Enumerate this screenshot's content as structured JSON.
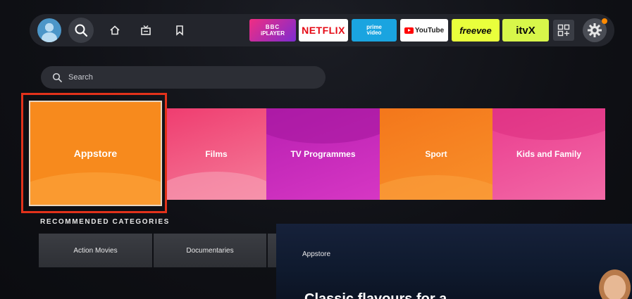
{
  "nav": {
    "items": [
      {
        "icon": "home-icon"
      },
      {
        "icon": "live-tv-icon"
      },
      {
        "icon": "bookmark-icon"
      }
    ],
    "apps": [
      {
        "name": "bbc_iplayer",
        "line1": "BBC",
        "line2": "iPLAYER"
      },
      {
        "name": "netflix",
        "label": "NETFLIX"
      },
      {
        "name": "prime_video",
        "line1": "prime",
        "line2": "video"
      },
      {
        "name": "youtube",
        "label": "YouTube"
      },
      {
        "name": "freevee",
        "label": "freevee"
      },
      {
        "name": "itvx",
        "label": "itvX"
      }
    ]
  },
  "search": {
    "placeholder": "Search"
  },
  "categories": [
    {
      "label": "Appstore",
      "color": "#f78a1d"
    },
    {
      "label": "Films",
      "color": "#ef3d70"
    },
    {
      "label": "TV Programmes",
      "color": "#c12bb9"
    },
    {
      "label": "Sport",
      "color": "#f4771b"
    },
    {
      "label": "Kids and Family",
      "color": "#ea3c8e"
    }
  ],
  "recommended": {
    "heading": "RECOMMENDED CATEGORIES",
    "items": [
      "Action Movies",
      "Documentaries"
    ]
  },
  "panel": {
    "label": "Appstore",
    "headline": "Classic flavours for a"
  },
  "colors": {
    "focus_outline": "#e2321b",
    "accent_notification": "#ff8a00"
  }
}
